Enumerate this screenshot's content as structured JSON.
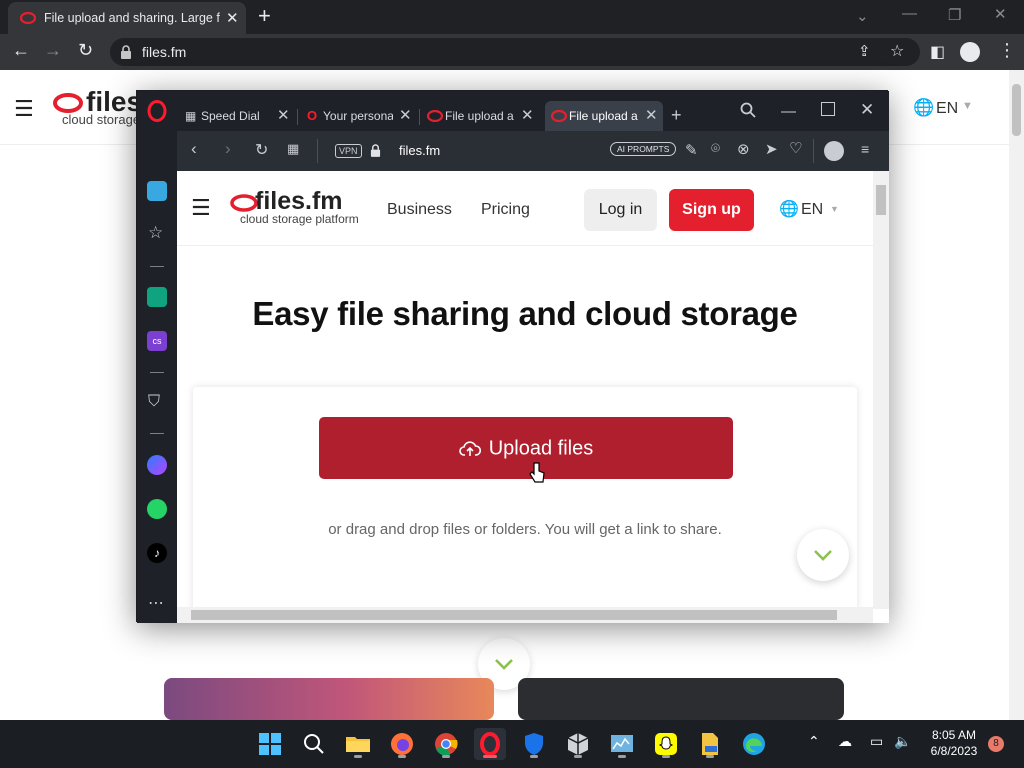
{
  "chrome": {
    "tab_title": "File upload and sharing. Large fil",
    "url": "files.fm"
  },
  "background_site": {
    "logo_text": "files",
    "logo_sub": "cloud storage",
    "language": "EN"
  },
  "opera": {
    "tabs": [
      {
        "label": "Speed Dial"
      },
      {
        "label": "Your persona"
      },
      {
        "label": "File upload a"
      },
      {
        "label": "File upload a"
      }
    ],
    "vpn_label": "VPN",
    "url": "files.fm",
    "ai_prompts_label": "AI PROMPTS"
  },
  "site": {
    "logo": "files.fm",
    "logo_sub": "cloud storage platform",
    "nav": {
      "business": "Business",
      "pricing": "Pricing"
    },
    "login": "Log in",
    "signup": "Sign up",
    "language": "EN",
    "hero_title": "Easy file sharing and cloud storage",
    "upload_button": "Upload files",
    "drop_text": "or drag and drop files or folders. You will get a link to share."
  },
  "taskbar": {
    "time": "8:05 AM",
    "date": "6/8/2023",
    "notification_count": "8"
  },
  "colors": {
    "brand_red": "#e5202e",
    "upload_red": "#b01f2d",
    "opera_dark": "#1e2228",
    "chrome_dark": "#202124"
  }
}
